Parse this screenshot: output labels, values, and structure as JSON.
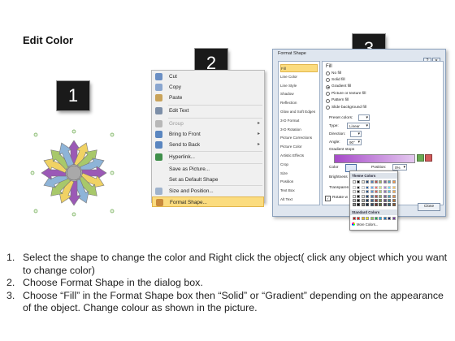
{
  "title": "Edit Color",
  "badges": {
    "one": "1",
    "two": "2",
    "three": "3"
  },
  "context_menu": {
    "items": [
      {
        "label": "Cut",
        "icon": "scissors-icon",
        "color": "#6b8fc4"
      },
      {
        "label": "Copy",
        "icon": "copy-icon",
        "color": "#8aa6cf"
      },
      {
        "label": "Paste",
        "icon": "clipboard-icon",
        "color": "#c9a35a"
      },
      {
        "label": "Edit Text",
        "icon": "text-box-icon",
        "color": "#7d8fa8"
      },
      {
        "label": "Group",
        "icon": "group-icon",
        "color": "#b8b8b8",
        "disabled": true,
        "submenu": true
      },
      {
        "label": "Bring to Front",
        "icon": "bring-front-icon",
        "color": "#5a86c0",
        "submenu": true
      },
      {
        "label": "Send to Back",
        "icon": "send-back-icon",
        "color": "#5a86c0",
        "submenu": true
      },
      {
        "label": "Hyperlink...",
        "icon": "globe-link-icon",
        "color": "#3f8f4a"
      },
      {
        "label": "Save as Picture...",
        "icon": "",
        "color": ""
      },
      {
        "label": "Set as Default Shape",
        "icon": "",
        "color": ""
      },
      {
        "label": "Size and Position...",
        "icon": "resize-icon",
        "color": "#9fb3cc"
      },
      {
        "label": "Format Shape...",
        "icon": "format-shape-icon",
        "color": "#c98a3c",
        "highlighted": true
      }
    ]
  },
  "dialog": {
    "title": "Format Shape",
    "close_label": "Close",
    "nav": [
      "Fill",
      "Line Color",
      "Line Style",
      "Shadow",
      "Reflection",
      "Glow and Soft Edges",
      "3-D Format",
      "3-D Rotation",
      "Picture Corrections",
      "Picture Color",
      "Artistic Effects",
      "Crop",
      "Size",
      "Position",
      "Text Box",
      "Alt Text"
    ],
    "selected_nav": "Fill",
    "pane_heading": "Fill",
    "fill_options": [
      "No fill",
      "Solid fill",
      "Gradient fill",
      "Picture or texture fill",
      "Pattern fill",
      "Slide background fill"
    ],
    "selected_fill": "Gradient fill",
    "preset_colors_label": "Preset colors:",
    "type_label": "Type:",
    "type_value": "Linear",
    "direction_label": "Direction:",
    "angle_label": "Angle:",
    "angle_value": "90°",
    "gradient_stops_label": "Gradient stops",
    "color_label": "Color",
    "position_label": "Position:",
    "position_value": "0%",
    "brightness_label": "Brightness",
    "transparency_label": "Transparen",
    "rotate_label": "Rotate w",
    "palette": {
      "theme_label": "Theme Colors",
      "standard_label": "Standard Colors",
      "more_label": "More Colors...",
      "theme_row": [
        "#ffffff",
        "#000000",
        "#eeece1",
        "#1f497d",
        "#4f81bd",
        "#c0504d",
        "#9bbb59",
        "#8064a2",
        "#4bacc6",
        "#f79646"
      ],
      "standard_row": [
        "#c00000",
        "#ff0000",
        "#ffc000",
        "#ffff00",
        "#92d050",
        "#00b050",
        "#00b0f0",
        "#0070c0",
        "#002060",
        "#7030a0"
      ]
    },
    "gradient_bar_color": "#a64ac9"
  },
  "steps": [
    {
      "num": "1.",
      "text": "Select the shape to change the color and Right click the object( click any object which you want to change color)"
    },
    {
      "num": "2.",
      "text": "Choose Format Shape in the dialog box."
    },
    {
      "num": "3.",
      "text": "Choose “Fill” in the Format Shape box then “Solid” or “Gradient” depending on the appearance of the object. Change colour as shown in the picture."
    }
  ],
  "shape_colors": {
    "purple": "#9b59b6",
    "yellow": "#f0d264",
    "green": "#a8c86a",
    "blue": "#8eb4d8",
    "center": "#a9a9a9"
  }
}
